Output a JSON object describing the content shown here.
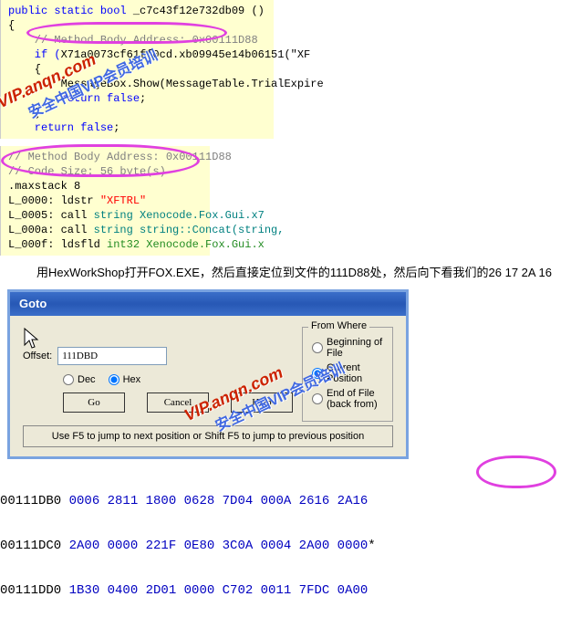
{
  "code1": {
    "l1_public": "public static bool ",
    "l1_name": "_c7c43f12e732db09",
    "l1_tail": " ()",
    "l2": "{",
    "l3_comment": "    // Method Body Address: 0x00111D88",
    "l4_a": "    if (",
    "l4_b": "X71a0073cf61ff0cd",
    "l4_c": ".",
    "l4_d": "xb09945e14b06151",
    "l4_e": "(\"XF",
    "l5": "    {",
    "l6_a": "        MessageBox.",
    "l6_b": "Show",
    "l6_c": "(MessageTable.TrialExpire",
    "l7_a": "        return ",
    "l7_b": "false",
    "l7_c": ";",
    "l8": "    }",
    "l9_a": "    return ",
    "l9_b": "false",
    "l9_c": ";"
  },
  "code2": {
    "l1_comment": "// Method Body Address: 0x00111D88",
    "l2_comment": "// Code Size: 56 byte(s)",
    "l3": ".maxstack 8",
    "l4_a": "L_0000: ldstr ",
    "l4_b": "\"XFTRL\"",
    "l5_a": "L_0005: call ",
    "l5_b": "string Xenocode.Fox.Gui.x7",
    "l6_a": "L_000a: call ",
    "l6_b": "string string::Concat(string,",
    "l7_a": "L_000f: ldsfld ",
    "l7_b": "int32 Xenocode.Fox.Gui.x"
  },
  "paragraph": "用HexWorkShop打开FOX.EXE，然后直接定位到文件的111D88处，然后向下看我们的26 17 2A 16",
  "dialog": {
    "title": "Goto",
    "offset_label": "Offset:",
    "offset_value": "111DBD",
    "dec_label": "Dec",
    "hex_label": "Hex",
    "go_label": "Go",
    "cancel_label": "Cancel",
    "help_label": "Help",
    "fromwhere_title": "From Where",
    "fw_begin": "Beginning of File",
    "fw_current": "Current Position",
    "fw_end": "End of File (back from)",
    "hint": "Use F5 to jump to next position or Shift F5 to jump to previous position"
  },
  "hex": {
    "asciiA": " ",
    "asciiB": "*",
    "asciiC": " ",
    "r1_addr": "00111DB0",
    "r1_vals": " 0006 2811 1800 0628 7D04 000A 2616 2A16",
    "r2_addr": "00111DC0",
    "r2_vals": " 2A00 0000 221F 0E80 3C0A 0004 2A00 0000",
    "r3_addr": "00111DD0",
    "r3_vals": " 1B30 0400 2D01 0000 C702 0011 7FDC 0A00"
  },
  "watermark": {
    "en": "VIP.anqn.com",
    "cn": "安全中国VIP会员培训"
  }
}
